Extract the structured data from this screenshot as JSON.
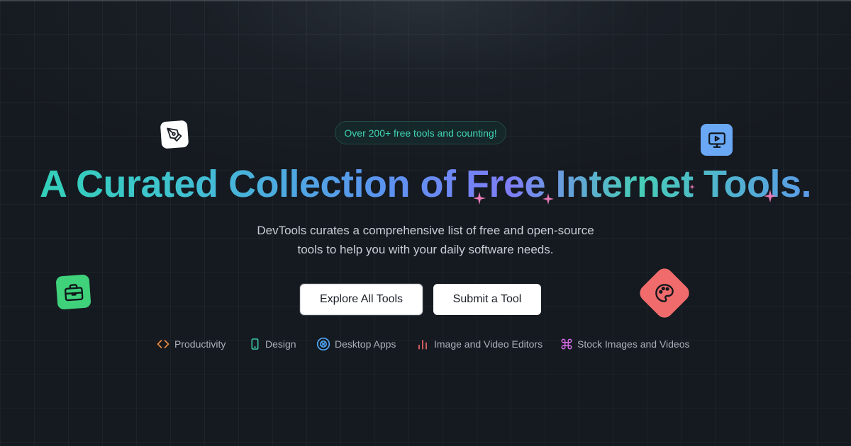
{
  "hero": {
    "badge": "Over 200+ free tools and counting!",
    "headline": "A Curated Collection of Free Internet Tools.",
    "subtitle_line1": "DevTools curates a comprehensive list of free and open-source",
    "subtitle_line2": "tools to help you with your daily software needs."
  },
  "buttons": {
    "explore": "Explore All Tools",
    "submit": "Submit a Tool"
  },
  "categories": [
    {
      "label": "Productivity",
      "icon": "code-brackets-icon",
      "color": "#f0893a"
    },
    {
      "label": "Design",
      "icon": "mobile-device-icon",
      "color": "#3fd4b4"
    },
    {
      "label": "Desktop Apps",
      "icon": "circle-x-icon",
      "color": "#4fa6f5"
    },
    {
      "label": "Image and Video Editors",
      "icon": "bar-chart-icon",
      "color": "#f06b6b"
    },
    {
      "label": "Stock Images and Videos",
      "icon": "command-key-icon",
      "color": "#d66be8"
    }
  ],
  "decor": {
    "pen_tile_color": "#ffffff",
    "monitor_tile_color": "#6aa8f5",
    "bag_tile_color": "#3fd27a",
    "palette_tile_color": "#f06b6b",
    "sparkle_color": "#e879b8"
  }
}
